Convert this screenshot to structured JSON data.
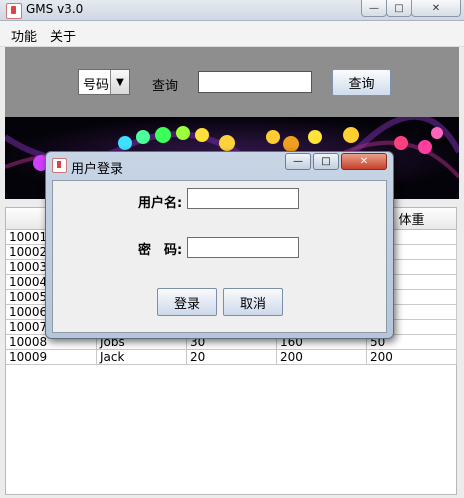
{
  "window": {
    "title": "GMS v3.0",
    "min": "—",
    "max": "□",
    "close": "✕"
  },
  "menu": [
    {
      "label": "功能"
    },
    {
      "label": "关于"
    }
  ],
  "search": {
    "field_selected": "号码",
    "query_label": "查询",
    "query_value": "",
    "query_button": "查询"
  },
  "table": {
    "visible_header": "体重",
    "rows": [
      {
        "id": "10001",
        "name": "",
        "age": "",
        "height": "",
        "weight": ""
      },
      {
        "id": "10002",
        "name": "",
        "age": "",
        "height": "",
        "weight": ""
      },
      {
        "id": "10003",
        "name": "",
        "age": "",
        "height": "",
        "weight": ""
      },
      {
        "id": "10004",
        "name": "",
        "age": "",
        "height": "",
        "weight": ""
      },
      {
        "id": "10005",
        "name": "",
        "age": "",
        "height": "",
        "weight": ""
      },
      {
        "id": "10006",
        "name": "",
        "age": "",
        "height": "",
        "weight": ""
      },
      {
        "id": "10007",
        "name": "",
        "age": "",
        "height": "",
        "weight": ""
      },
      {
        "id": "10008",
        "name": "Jobs",
        "age": "30",
        "height": "160",
        "weight": "50"
      },
      {
        "id": "10009",
        "name": "Jack",
        "age": "20",
        "height": "200",
        "weight": "200"
      }
    ]
  },
  "dialog": {
    "title": "用户登录",
    "username_label": "用户名:",
    "password_label": "密　码:",
    "username_value": "",
    "password_value": "",
    "login_button": "登录",
    "cancel_button": "取消",
    "min": "—",
    "max": "□",
    "close": "✕"
  }
}
